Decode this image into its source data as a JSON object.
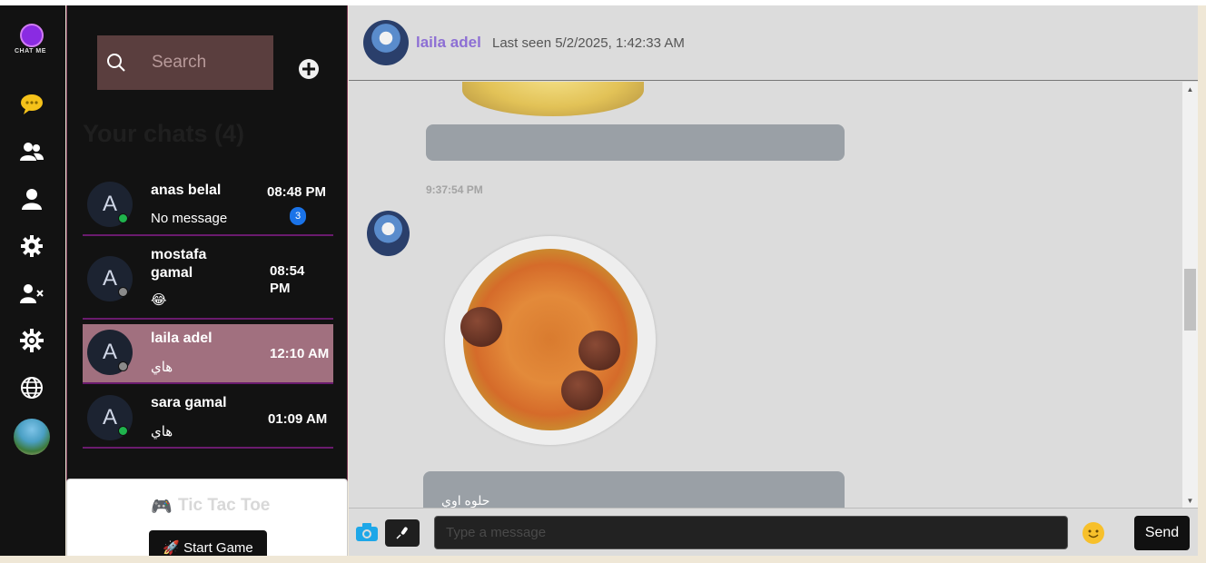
{
  "rail": {
    "logo_text": "CHAT ME",
    "icons": [
      "chat-bubble-icon",
      "users-icon",
      "user-icon",
      "gear-icon",
      "user-block-icon",
      "sun-settings-icon",
      "globe-icon",
      "profile-avatar"
    ]
  },
  "search": {
    "placeholder": "Search"
  },
  "chats_title": "Your chats (4)",
  "chats": [
    {
      "initial": "A",
      "name": "anas belal",
      "last": "No message",
      "time": "08:48 PM",
      "unread": "3",
      "status": "online"
    },
    {
      "initial": "A",
      "name": "mostafa gamal",
      "last": "😂",
      "time": "08:54 PM",
      "status": "offline"
    },
    {
      "initial": "A",
      "name": "laila adel",
      "last": "هاي",
      "time": "12:10 AM",
      "status": "offline",
      "active": true
    },
    {
      "initial": "A",
      "name": "sara gamal",
      "last": "هاي",
      "time": "01:09 AM",
      "status": "online"
    }
  ],
  "game": {
    "icon": "🎮",
    "title": "Tic Tac Toe",
    "start_label": "🚀 Start Game"
  },
  "conversation": {
    "name": "laila adel",
    "last_seen": "Last seen 5/2/2025, 1:42:33 AM",
    "msg_time": "9:37:54 PM",
    "bubble_text": "حلوه اوي"
  },
  "composer": {
    "placeholder": "Type a message",
    "send_label": "Send"
  },
  "colors": {
    "accent_purple": "#8d6fd4",
    "active_chat": "#a1707f",
    "divider": "#6a1b6e",
    "unread_badge": "#1a73e8",
    "online": "#1fb34d"
  }
}
